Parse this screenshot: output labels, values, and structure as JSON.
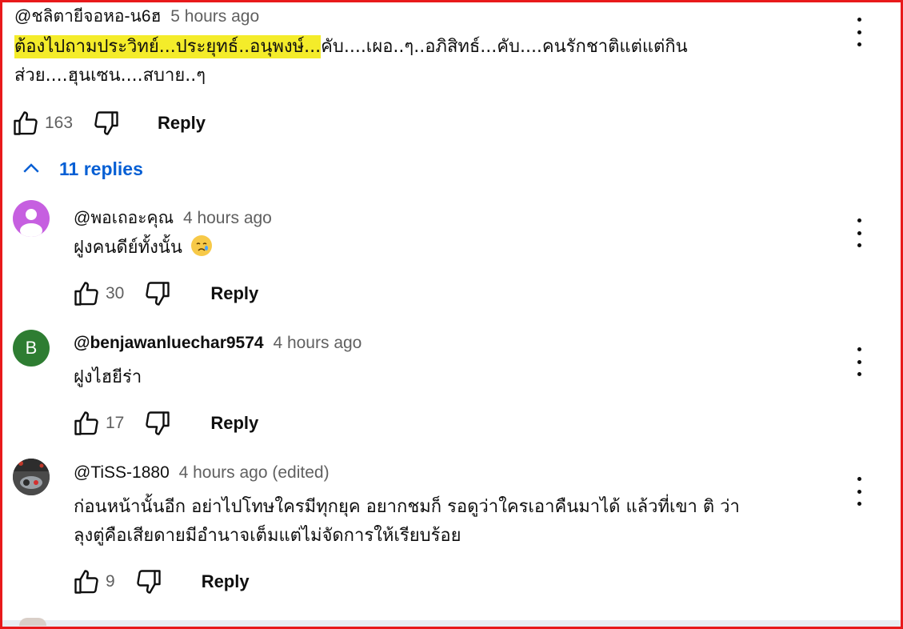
{
  "top_comment": {
    "author": "@ชลิตายีจอหอ-น6ฮ",
    "time": "5 hours ago",
    "text_highlighted": "ต้องไปถามประวิทย์...ประยุทธ์..อนุพงษ์...",
    "text_line1_rest": "คับ....เผอ..ๆ..อภิสิทธ์...คับ....คนรักชาติแต่แต่กิน",
    "text_line2": "ส่วย....ฮุนเซน....สบาย..ๆ",
    "likes": "163",
    "reply_label": "Reply"
  },
  "replies_toggle": {
    "label": "11 replies",
    "color": "#065fd4"
  },
  "replies": [
    {
      "author": "@พอเถอะคุณ",
      "time": "4 hours ago",
      "text": "ฝูงคนดีย์ทั้งนั้น",
      "emoji": "crying-face-icon",
      "likes": "30",
      "reply_label": "Reply",
      "avatar_color": "#b24bd6"
    },
    {
      "author": "@benjawanluechar9574",
      "time": "4 hours ago",
      "text": "ฝูงไฮยีร่า",
      "likes": "17",
      "reply_label": "Reply",
      "avatar_letter": "B",
      "avatar_color": "#2e7d32"
    },
    {
      "author": "@TiSS-1880",
      "time": "4 hours ago (edited)",
      "text_line1": "ก่อนหน้านั้นอีก อย่าไปโทษใครมีทุกยุค อยากชมก็ รอดูว่าใครเอาคืนมาได้ แล้วที่เขา ติ ว่า",
      "text_line2": "ลุงตู่คือเสียดายมีอำนาจเต็มแต่ไม่จัดการให้เรียบร้อย",
      "likes": "9",
      "reply_label": "Reply"
    }
  ],
  "icons": {
    "like": "thumbs-up-icon",
    "dislike": "thumbs-down-icon",
    "menu": "more-vertical-icon",
    "collapse": "chevron-up-icon"
  },
  "colors": {
    "highlight": "#f4ec2a",
    "frame": "#e8191b",
    "muted": "#606060"
  }
}
